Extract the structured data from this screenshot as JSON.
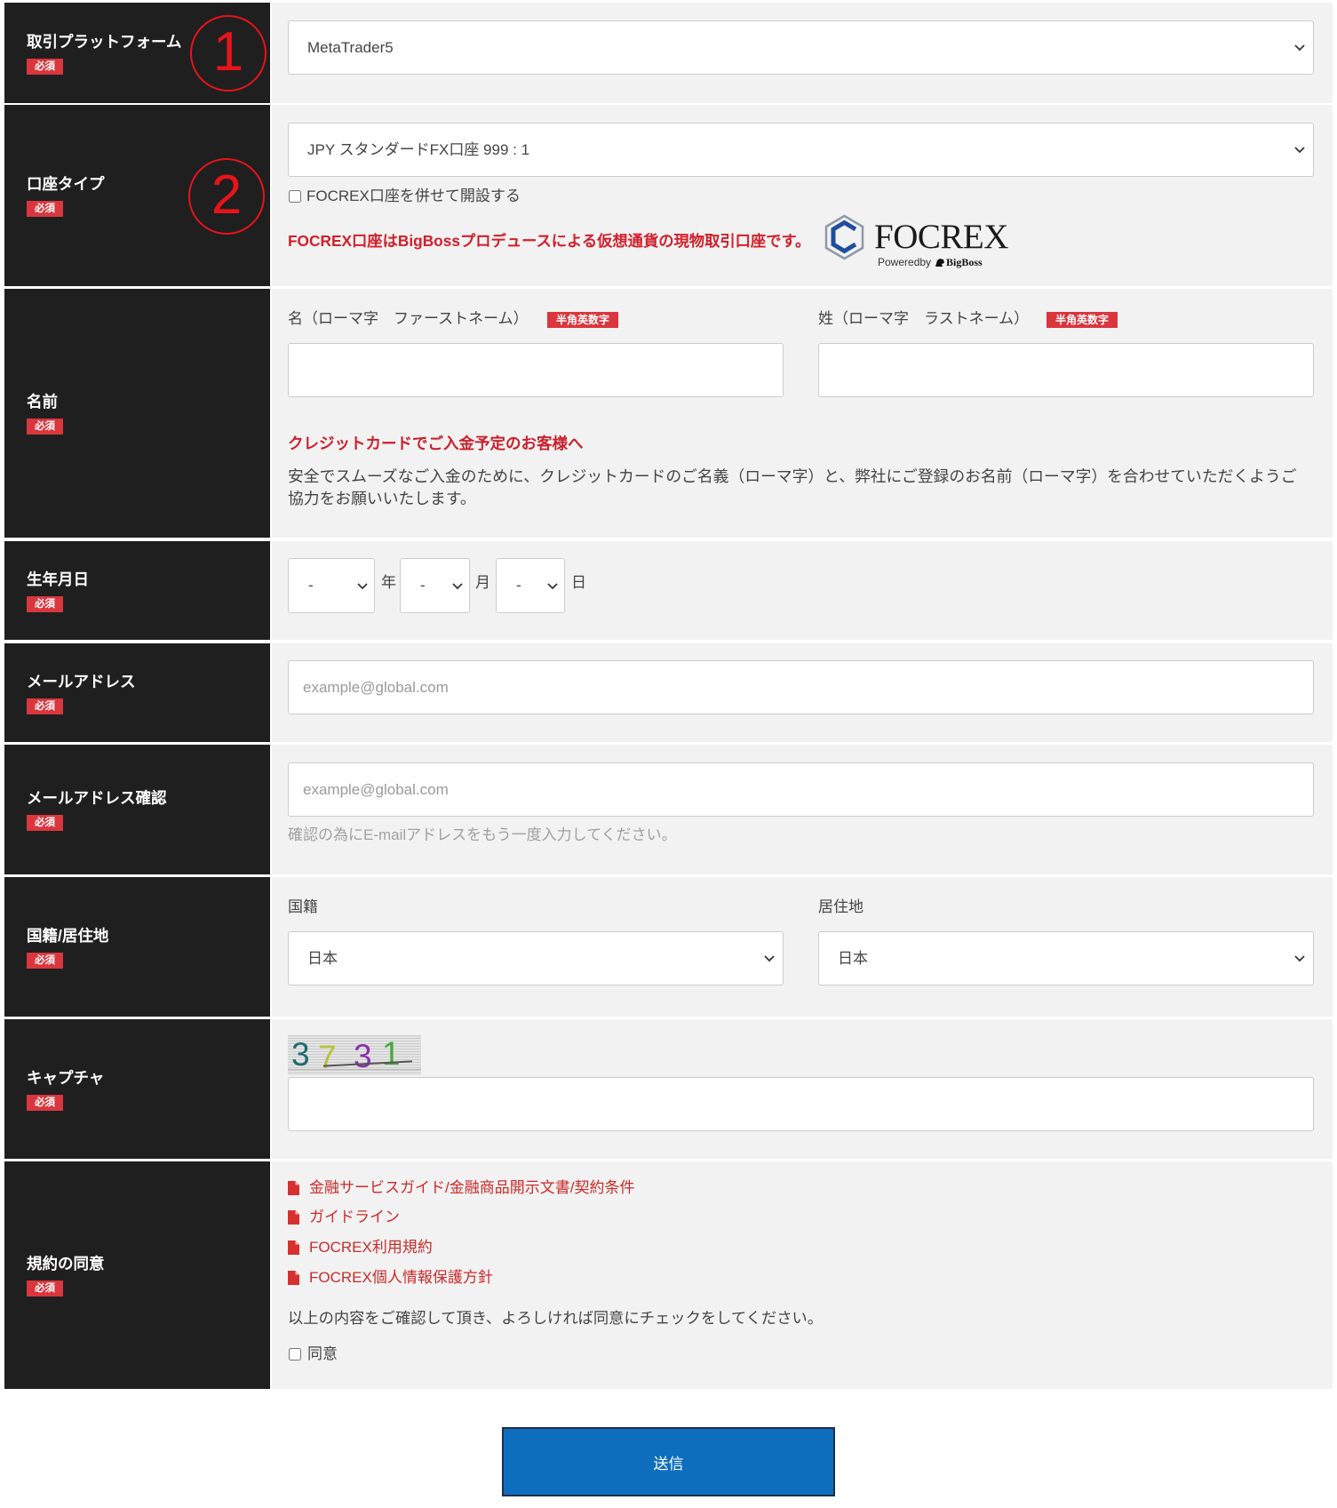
{
  "colors": {
    "label_bg": "#1f1f1f",
    "field_bg": "#f2f2f2",
    "required_badge": "#d9363e",
    "accent_red": "#d21f2b",
    "link_red": "#cc2b2b",
    "submit_bg": "#0d6ebd",
    "annotation_red": "#e8131b"
  },
  "icons": {
    "select_arrow": "chevron-down-icon",
    "document": "file-pdf-icon",
    "focrex_logo": "focrex-hexagon-icon",
    "annotation": "circled-number"
  },
  "annotations": [
    "1",
    "2"
  ],
  "required_badge": "必須",
  "platform": {
    "label": "取引プラットフォーム",
    "selected": "MetaTrader5"
  },
  "account_type": {
    "label": "口座タイプ",
    "selected": "JPY スタンダードFX口座 999 : 1",
    "focrex_option": {
      "label": "FOCREX口座を併せて開設する",
      "checked": false
    },
    "focrex_note": "FOCREX口座はBigBossプロデュースによる仮想通貨の現物取引口座です。",
    "focrex_logo": {
      "name": "FOCREX",
      "powered_by": "Poweredby",
      "brand": "BigBoss"
    }
  },
  "name": {
    "label": "名前",
    "first": {
      "label": "名（ローマ字　ファーストネーム）",
      "badge": "半角英数字",
      "value": ""
    },
    "last": {
      "label": "姓（ローマ字　ラストネーム）",
      "badge": "半角英数字",
      "value": ""
    },
    "notice_title": "クレジットカードでご入金予定のお客様へ",
    "notice_text": "安全でスムーズなご入金のために、クレジットカードのご名義（ローマ字）と、弊社にご登録のお名前（ローマ字）を合わせていただくようご協力をお願いいたします。"
  },
  "birthdate": {
    "label": "生年月日",
    "year": {
      "selected": "-",
      "unit": "年"
    },
    "month": {
      "selected": "-",
      "unit": "月"
    },
    "day": {
      "selected": "-",
      "unit": "日"
    }
  },
  "email": {
    "label": "メールアドレス",
    "placeholder": "example@global.com",
    "value": ""
  },
  "email_confirm": {
    "label": "メールアドレス確認",
    "placeholder": "example@global.com",
    "value": "",
    "help": "確認の為にE-mailアドレスをもう一度入力してください。"
  },
  "nationality_residence": {
    "label": "国籍/居住地",
    "nationality": {
      "label": "国籍",
      "selected": "日本"
    },
    "residence": {
      "label": "居住地",
      "selected": "日本"
    }
  },
  "captcha": {
    "label": "キャプチャ",
    "digits": [
      {
        "char": "3",
        "color": "#1e6b6e"
      },
      {
        "char": "7",
        "color": "#b5c23a"
      },
      {
        "char": "3",
        "color": "#8b2fb0"
      },
      {
        "char": "1",
        "color": "#45a83a"
      }
    ],
    "value": ""
  },
  "terms": {
    "label": "規約の同意",
    "documents": [
      "金融サービスガイド/金融商品開示文書/契約条件",
      "ガイドライン",
      "FOCREX利用規約",
      "FOCREX個人情報保護方針"
    ],
    "instruction": "以上の内容をご確認して頂き、よろしければ同意にチェックをしてください。",
    "agree": {
      "label": "同意",
      "checked": false
    }
  },
  "submit_label": "送信"
}
